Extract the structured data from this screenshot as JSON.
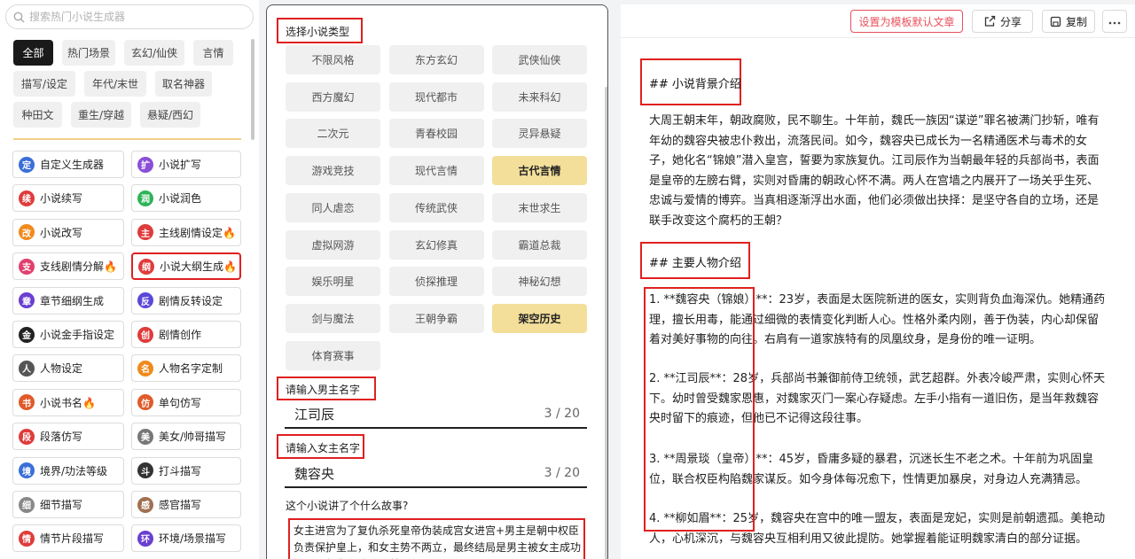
{
  "search": {
    "placeholder": "搜索热门小说生成器"
  },
  "categories": [
    {
      "label": "全部",
      "active": true
    },
    {
      "label": "热门场景"
    },
    {
      "label": "玄幻/仙侠"
    },
    {
      "label": "言情"
    },
    {
      "label": "描写/设定"
    },
    {
      "label": "年代/末世"
    },
    {
      "label": "取名神器"
    },
    {
      "label": "种田文"
    },
    {
      "label": "重生/穿越"
    },
    {
      "label": "悬疑/西幻"
    }
  ],
  "tools": [
    {
      "label": "自定义生成器",
      "glyph": "定",
      "color": "#3b6fd8"
    },
    {
      "label": "小说扩写",
      "glyph": "扩",
      "color": "#8a4fd8"
    },
    {
      "label": "小说续写",
      "glyph": "续",
      "color": "#e03b3b"
    },
    {
      "label": "小说润色",
      "glyph": "润",
      "color": "#2fb35a"
    },
    {
      "label": "小说改写",
      "glyph": "改",
      "color": "#f08a1c"
    },
    {
      "label": "主线剧情设定🔥",
      "glyph": "主",
      "color": "#e03b3b"
    },
    {
      "label": "支线剧情分解🔥",
      "glyph": "支",
      "color": "#e0406e"
    },
    {
      "label": "小说大纲生成🔥",
      "glyph": "纲",
      "color": "#e03b3b"
    },
    {
      "label": "章节细纲生成",
      "glyph": "章",
      "color": "#6a3fd0"
    },
    {
      "label": "剧情反转设定",
      "glyph": "反",
      "color": "#5a48d8"
    },
    {
      "label": "小说金手指设定",
      "glyph": "金",
      "color": "#222222"
    },
    {
      "label": "剧情创作",
      "glyph": "创",
      "color": "#e03b3b"
    },
    {
      "label": "人物设定",
      "glyph": "人",
      "color": "#555555"
    },
    {
      "label": "人物名字定制",
      "glyph": "名",
      "color": "#f08a1c"
    },
    {
      "label": "小说书名🔥",
      "glyph": "书",
      "color": "#e05a2a"
    },
    {
      "label": "单句仿写",
      "glyph": "仿",
      "color": "#e05a2a"
    },
    {
      "label": "段落仿写",
      "glyph": "段",
      "color": "#e03b3b"
    },
    {
      "label": "美女/帅哥描写",
      "glyph": "美",
      "color": "#777777"
    },
    {
      "label": "境界/功法等级",
      "glyph": "境",
      "color": "#3b6fd8"
    },
    {
      "label": "打斗描写",
      "glyph": "斗",
      "color": "#333333"
    },
    {
      "label": "细节描写",
      "glyph": "细",
      "color": "#888888"
    },
    {
      "label": "感官描写",
      "glyph": "感",
      "color": "#a07050"
    },
    {
      "label": "情节片段描写",
      "glyph": "情",
      "color": "#e03b3b"
    },
    {
      "label": "环境/场景描写",
      "glyph": "环",
      "color": "#6a3fd0"
    }
  ],
  "form": {
    "genre_label": "选择小说类型",
    "genres": [
      {
        "label": "不限风格"
      },
      {
        "label": "东方玄幻"
      },
      {
        "label": "武侠仙侠"
      },
      {
        "label": "西方魔幻"
      },
      {
        "label": "现代都市"
      },
      {
        "label": "未来科幻"
      },
      {
        "label": "二次元"
      },
      {
        "label": "青春校园"
      },
      {
        "label": "灵异悬疑"
      },
      {
        "label": "游戏竞技"
      },
      {
        "label": "现代言情"
      },
      {
        "label": "古代言情",
        "selected": true
      },
      {
        "label": "同人虐恋"
      },
      {
        "label": "传统武侠"
      },
      {
        "label": "末世求生"
      },
      {
        "label": "虚拟网游"
      },
      {
        "label": "玄幻修真"
      },
      {
        "label": "霸道总裁"
      },
      {
        "label": "娱乐明星"
      },
      {
        "label": "侦探推理"
      },
      {
        "label": "神秘幻想"
      },
      {
        "label": "剑与魔法"
      },
      {
        "label": "王朝争霸"
      },
      {
        "label": "架空历史",
        "selected": true
      },
      {
        "label": "体育赛事"
      }
    ],
    "male_label": "请输入男主名字",
    "male_value": "江司辰",
    "male_count": "3 / 20",
    "female_label": "请输入女主名字",
    "female_value": "魏容央",
    "female_count": "3 / 20",
    "story_label": "这个小说讲了个什么故事?",
    "story_value": "女主进宫为了复仇杀死皇帝伪装成宫女进宫+男主是朝中权臣负责保护皇上，和女主势不两立，最终结局是男主被女主成功策反，帮女主成功登基王朝"
  },
  "toolbar": {
    "set_default": "设置为模板默认文章",
    "share": "分享",
    "copy": "复制"
  },
  "article": {
    "h_bg": "## 小说背景介绍",
    "bg": "大周王朝末年，朝政腐败，民不聊生。十年前，魏氏一族因“谋逆”罪名被满门抄斩，唯有年幼的魏容央被忠仆救出，流落民间。如今，魏容央已成长为一名精通医术与毒术的女子，她化名“锦娘”潜入皇宫，誓要为家族复仇。江司辰作为当朝最年轻的兵部尚书，表面是皇帝的左膀右臂，实则对昏庸的朝政心怀不满。两人在宫墙之内展开了一场关乎生死、忠诚与爱情的博弈。当真相逐渐浮出水面，他们必须做出抉择：是坚守各自的立场，还是联手改变这个腐朽的王朝？",
    "h_chars": "## 主要人物介绍",
    "c1": "1. **魏容央（锦娘）**：23岁，表面是太医院新进的医女，实则背负血海深仇。她精通药理，擅长用毒，能通过细微的表情变化判断人心。性格外柔内刚，善于伪装，内心却保留着对美好事物的向往。右肩有一道家族特有的凤凰纹身，是身份的唯一证明。",
    "c2": "2. **江司辰**：28岁，兵部尚书兼御前侍卫统领，武艺超群。外表冷峻严肃，实则心怀天下。幼时曾受魏家恩惠，对魏家灭门一案心存疑虑。左手小指有一道旧伤，是当年救魏容央时留下的痕迹，但他已不记得这段往事。",
    "c3": "3. **周景琰（皇帝）**：45岁，昏庸多疑的暴君，沉迷长生不老之术。十年前为巩固皇位，联合权臣构陷魏家谋反。如今身体每况愈下，性情更加暴戾，对身边人充满猜忌。",
    "c4": "4. **柳如眉**：25岁，魏容央在宫中的唯一盟友，表面是宠妃，实则是前朝遗孤。美艳动人，心机深沉，与魏容央互相利用又彼此提防。她掌握着能证明魏家清白的部分证据。"
  }
}
